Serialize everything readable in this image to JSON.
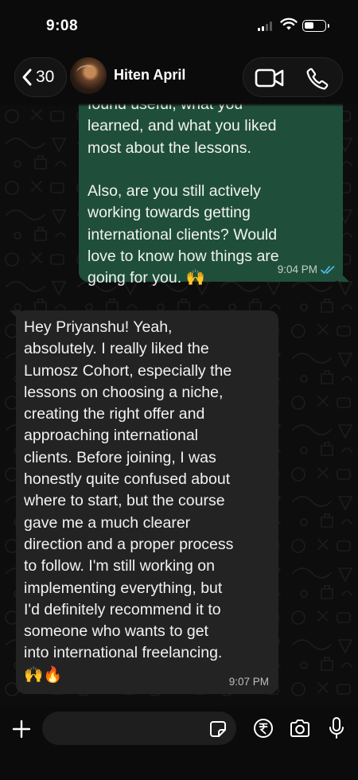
{
  "status_bar": {
    "time": "9:08"
  },
  "header": {
    "back_count": "30",
    "contact_name": "Hiten April"
  },
  "messages": [
    {
      "direction": "outgoing",
      "text": "found useful, what you\nlearned, and what you liked\nmost about the lessons.\n\nAlso, are you still actively\nworking towards getting\ninternational clients? Would\nlove to know how things are\ngoing for you. 🙌",
      "time": "9:04 PM",
      "status_icon": "double-check-read-icon"
    },
    {
      "direction": "incoming",
      "text": "Hey Priyanshu! Yeah,\nabsolutely. I really liked the\nLumosz Cohort, especially the\nlessons on choosing a niche,\ncreating the right offer and\napproaching international\nclients. Before joining, I was\nhonestly quite confused about\nwhere to start, but the course\ngave me a much clearer\ndirection and a proper process\nto follow. I'm still working on\nimplementing everything, but\nI'd definitely recommend it to\nsomeone who wants to get\ninto international freelancing.\n🙌🔥",
      "time": "9:07 PM"
    }
  ],
  "input_bar": {
    "placeholder": ""
  },
  "icons": [
    "chevron-left-icon",
    "video-icon",
    "phone-icon",
    "plus-icon",
    "sticker-icon",
    "rupee-icon",
    "camera-icon",
    "mic-icon"
  ],
  "colors": {
    "outgoing_bubble": "#1f4f3a",
    "incoming_bubble": "#232323",
    "read_tick": "#53bdeb",
    "background": "#0b0b0b"
  }
}
